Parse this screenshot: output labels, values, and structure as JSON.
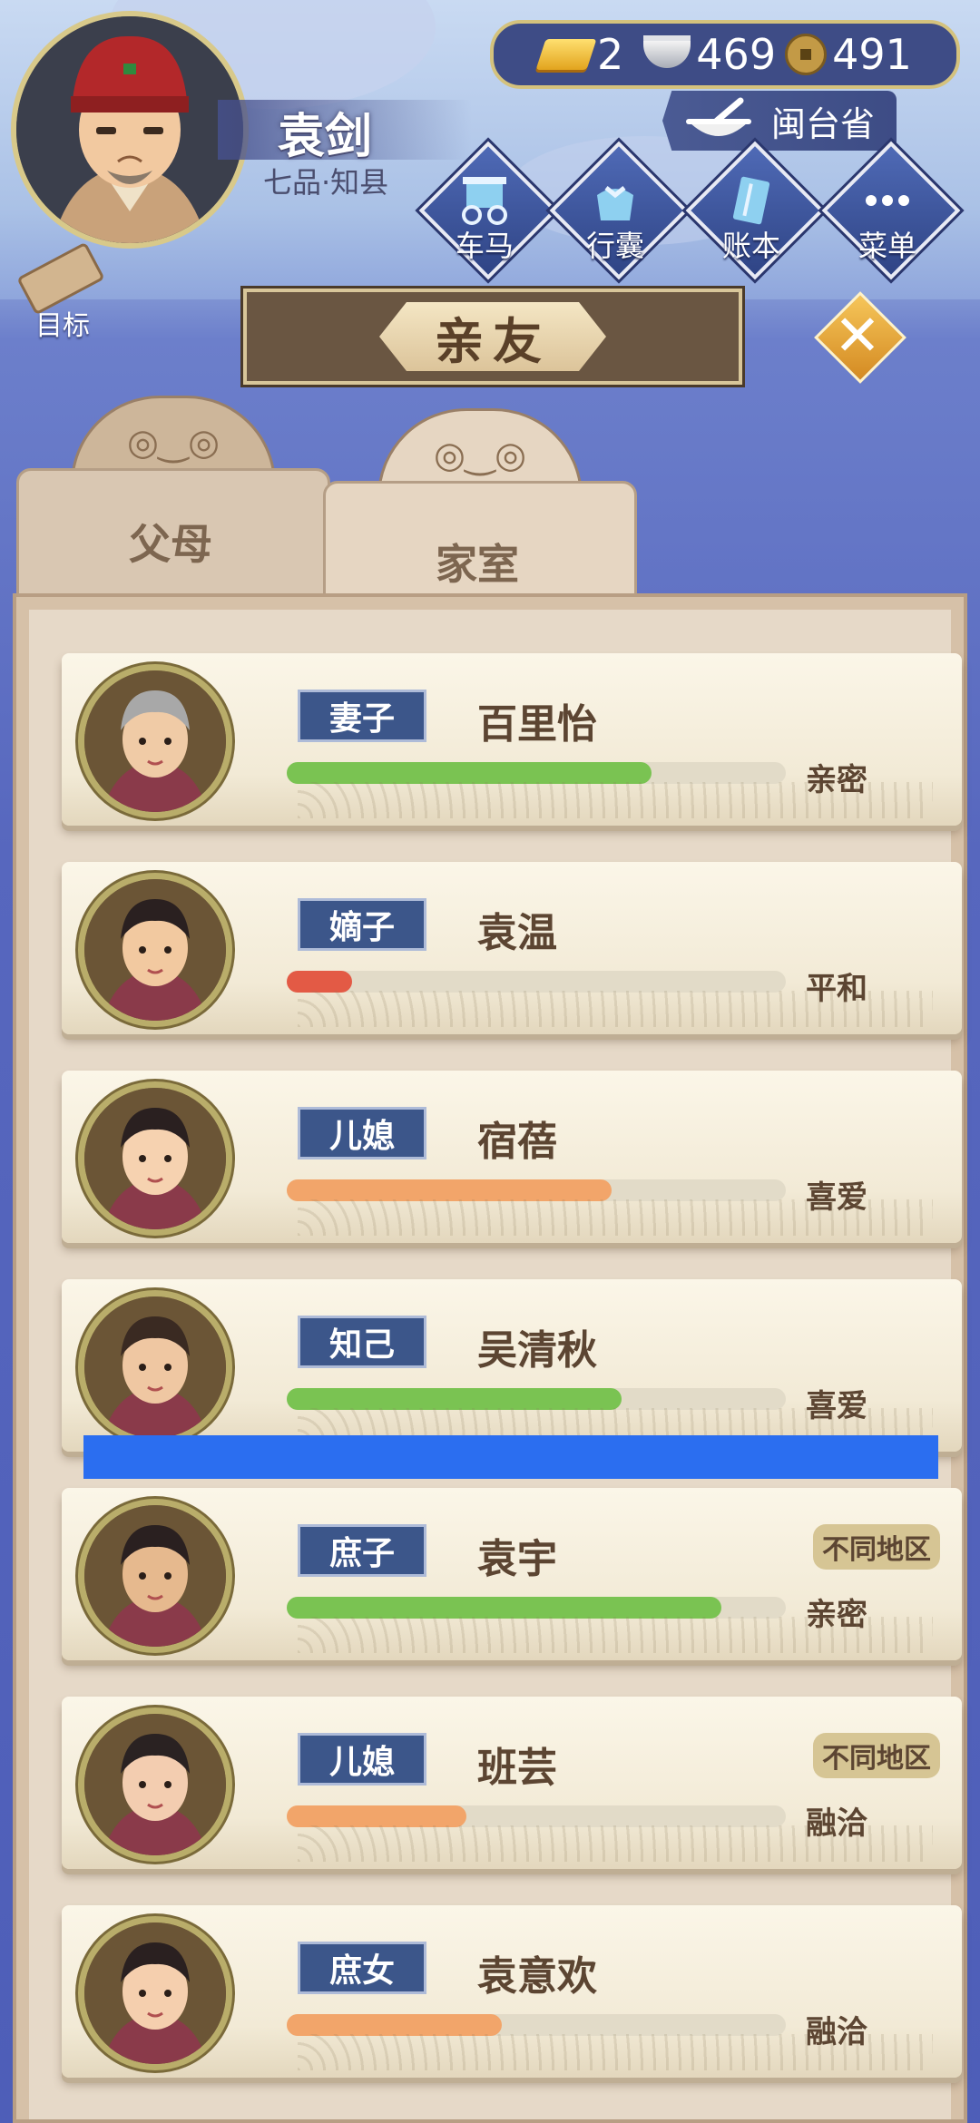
{
  "player": {
    "name": "袁剑",
    "rank": "七品·知县"
  },
  "currency": {
    "gold": "2",
    "silver": "469",
    "copper": "491"
  },
  "location": {
    "province": "闽台省"
  },
  "nav": [
    {
      "label": "车马",
      "icon": "carriage-icon"
    },
    {
      "label": "行囊",
      "icon": "bundle-icon"
    },
    {
      "label": "账本",
      "icon": "ledger-icon"
    },
    {
      "label": "菜单",
      "icon": "more-icon"
    }
  ],
  "goal": {
    "label": "目标",
    "icon": "scroll-icon"
  },
  "title": "亲友",
  "tabs": [
    {
      "label": "父母",
      "active": false
    },
    {
      "label": "家室",
      "active": true
    }
  ],
  "colors": {
    "green": "#7ac352",
    "red": "#e35a45",
    "orange": "#f2a56a",
    "tag": "#3c568a"
  },
  "members": [
    {
      "role": "妻子",
      "name": "百里怡",
      "relation": "亲密",
      "affinity": 0.73,
      "bar_color": "#7ac352",
      "region": ""
    },
    {
      "role": "嫡子",
      "name": "袁温",
      "relation": "平和",
      "affinity": 0.13,
      "bar_color": "#e35a45",
      "region": ""
    },
    {
      "role": "儿媳",
      "name": "宿蓓",
      "relation": "喜爱",
      "affinity": 0.65,
      "bar_color": "#f2a56a",
      "region": ""
    },
    {
      "role": "知己",
      "name": "吴清秋",
      "relation": "喜爱",
      "affinity": 0.67,
      "bar_color": "#7ac352",
      "region": ""
    },
    {
      "role": "庶子",
      "name": "袁宇",
      "relation": "亲密",
      "affinity": 0.87,
      "bar_color": "#7ac352",
      "region": "不同地区"
    },
    {
      "role": "儿媳",
      "name": "班芸",
      "relation": "融洽",
      "affinity": 0.36,
      "bar_color": "#f2a56a",
      "region": "不同地区"
    },
    {
      "role": "庶女",
      "name": "袁意欢",
      "relation": "融洽",
      "affinity": 0.43,
      "bar_color": "#f2a56a",
      "region": ""
    }
  ]
}
